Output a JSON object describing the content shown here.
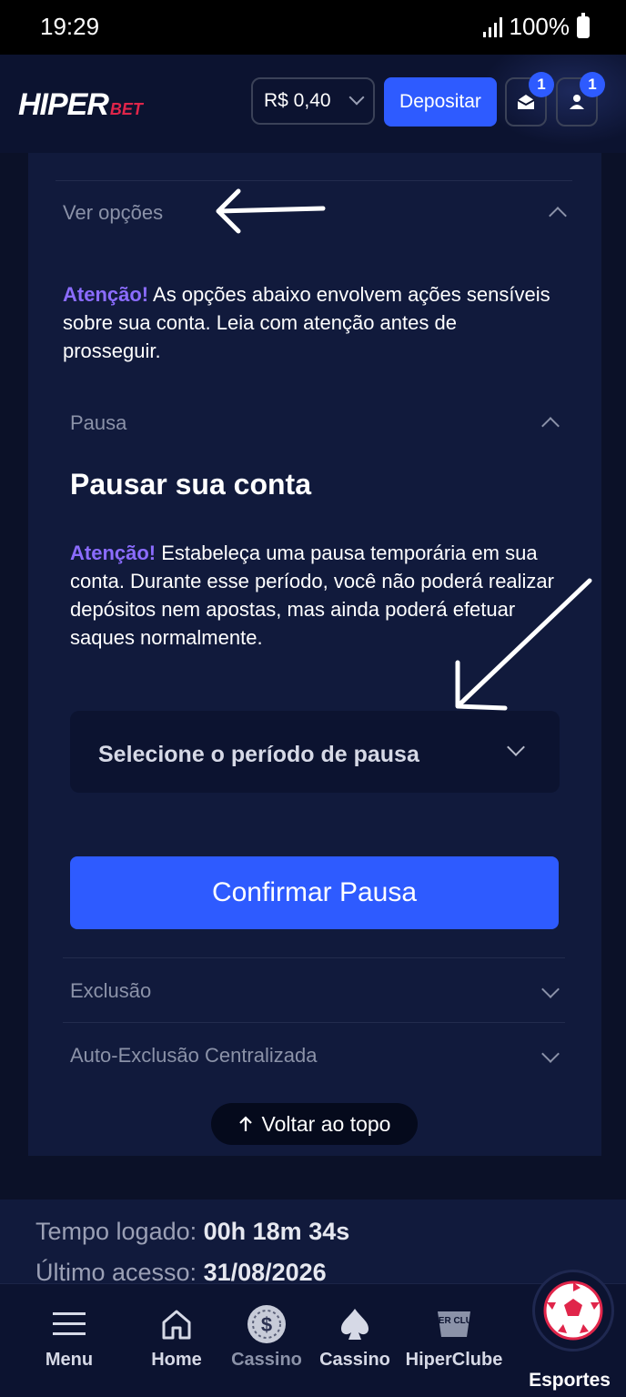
{
  "status_bar": {
    "time": "19:29",
    "battery": "100%"
  },
  "header": {
    "logo_main": "HIPER",
    "logo_sub": "BET",
    "balance": "R$ 0,40",
    "deposit_label": "Depositar",
    "messages_badge": "1",
    "profile_badge": "1"
  },
  "options": {
    "title": "Ver opções",
    "warning_label": "Atenção!",
    "warning_text": " As opções abaixo envolvem ações sensíveis sobre sua conta. Leia com atenção antes de prosseguir."
  },
  "pause": {
    "section_title": "Pausa",
    "heading": "Pausar sua conta",
    "warning_label": "Atenção!",
    "warning_text": " Estabeleça uma pausa temporária em sua conta. Durante esse período, você não poderá realizar depósitos nem apostas, mas ainda poderá efetuar saques normalmente.",
    "select_placeholder": "Selecione o período de pausa",
    "confirm_label": "Confirmar Pausa"
  },
  "sections": {
    "exclusion": "Exclusão",
    "central_exclusion": "Auto-Exclusão Centralizada"
  },
  "back_to_top": "Voltar ao topo",
  "session": {
    "logged_label": "Tempo logado: ",
    "logged_value": "00h 18m 34s",
    "last_label": "Último acesso: ",
    "last_value": "31/08/2026"
  },
  "nav": {
    "menu": "Menu",
    "home": "Home",
    "cassino1": "Cassino",
    "cassino2": "Cassino",
    "hiperclube": "HiperClube",
    "esportes": "Esportes",
    "hiperclube_icon_text": "HIPER CLUBE"
  }
}
